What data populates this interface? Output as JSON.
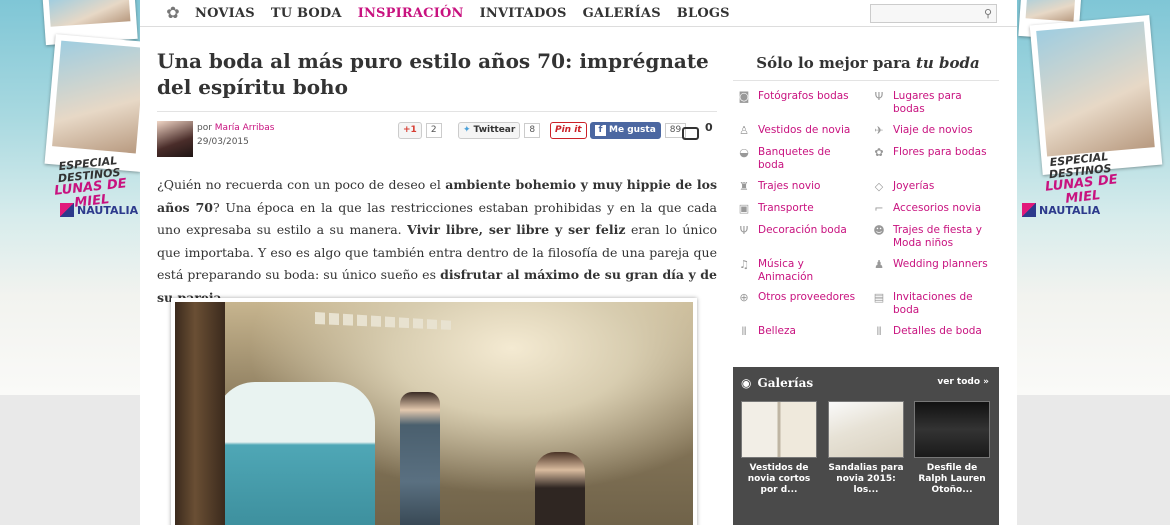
{
  "ads": {
    "left": {
      "caption_l1": "ESPECIAL DESTINOS",
      "caption_l2": "LUNAS DE MIEL",
      "brand": "NAUTALIA"
    },
    "right": {
      "caption_l1": "ESPECIAL DESTINOS",
      "caption_l2": "LUNAS DE MIEL",
      "brand": "NAUTALIA"
    }
  },
  "nav": {
    "items": [
      "NOVIAS",
      "TU BODA",
      "INSPIRACIÓN",
      "INVITADOS",
      "GALERÍAS",
      "BLOGS"
    ],
    "active": "INSPIRACIÓN"
  },
  "article": {
    "title": "Una boda al más puro estilo años 70: imprégnate del espíritu boho",
    "author_prefix": "por",
    "author": "María Arribas",
    "date": "29/03/2015",
    "share": {
      "gplus_label": "+1",
      "gplus_count": "2",
      "twitter_label": "Twittear",
      "twitter_count": "8",
      "pin_label": "Pin it",
      "fb_label": "Me gusta",
      "fb_count": "89",
      "comments": "0"
    },
    "body": [
      {
        "t": "¿Quién no recuerda con un poco de deseo el "
      },
      {
        "t": "ambiente bohemio y muy hippie de los años 70",
        "b": true
      },
      {
        "t": "? Una época en la que las restricciones estaban prohibidas y en la que cada uno expresaba su estilo a su manera. "
      },
      {
        "t": "Vivir libre, ser libre y ser feliz",
        "b": true
      },
      {
        "t": " eran lo único que importaba. Y eso es algo que también entra dentro de la filosofía de una pareja que está preparando su boda: su único sueño es "
      },
      {
        "t": "disfrutar al máximo de su gran día y de su pareja",
        "b": true
      },
      {
        "t": "."
      }
    ]
  },
  "sidebar": {
    "title_plain": "Sólo lo mejor para ",
    "title_italic": "tu boda",
    "categories": [
      {
        "label": "Fotógrafos bodas",
        "icon": "camera-icon"
      },
      {
        "label": "Lugares para bodas",
        "icon": "glass-icon"
      },
      {
        "label": "Vestidos de novia",
        "icon": "dress-icon"
      },
      {
        "label": "Viaje de novios",
        "icon": "plane-icon"
      },
      {
        "label": "Banquetes de boda",
        "icon": "food-icon"
      },
      {
        "label": "Flores para bodas",
        "icon": "flower-icon"
      },
      {
        "label": "Trajes novio",
        "icon": "suit-icon"
      },
      {
        "label": "Joyerías",
        "icon": "diamond-icon"
      },
      {
        "label": "Transporte",
        "icon": "bus-icon"
      },
      {
        "label": "Accesorios novia",
        "icon": "shoe-icon"
      },
      {
        "label": "Decoración boda",
        "icon": "candle-icon"
      },
      {
        "label": "Trajes de fiesta y Moda niños",
        "icon": "people-icon"
      },
      {
        "label": "Música y Animación",
        "icon": "music-icon"
      },
      {
        "label": "Wedding planners",
        "icon": "planner-icon"
      },
      {
        "label": "Otros proveedores",
        "icon": "plus-icon"
      },
      {
        "label": "Invitaciones de boda",
        "icon": "invitation-icon"
      },
      {
        "label": "Belleza",
        "icon": "beauty-icon"
      },
      {
        "label": "Detalles de boda",
        "icon": "gift-icon"
      }
    ]
  },
  "galleries": {
    "title": "Galerías",
    "see_all": "ver todo »",
    "items": [
      {
        "caption": "Vestidos de novia cortos por d..."
      },
      {
        "caption": "Sandalias para novia 2015: los..."
      },
      {
        "caption": "Desfile de Ralph Lauren Otoño..."
      }
    ]
  },
  "search": {
    "placeholder": ""
  }
}
